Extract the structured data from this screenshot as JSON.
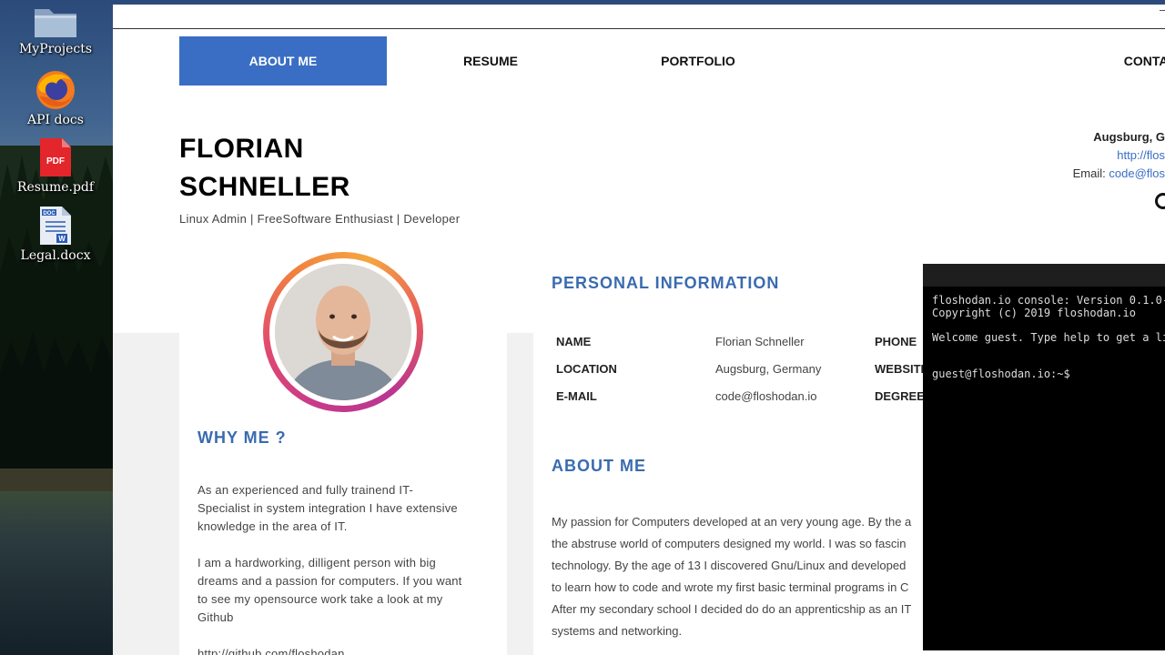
{
  "desktop": {
    "icons": [
      {
        "label": "MyProjects",
        "icon": "folder-icon"
      },
      {
        "label": "API docs",
        "icon": "firefox-icon"
      },
      {
        "label": "Resume.pdf",
        "icon": "pdf-file-icon",
        "badge": "PDF"
      },
      {
        "label": "Legal.docx",
        "icon": "docx-file-icon",
        "badge": "DOC"
      }
    ]
  },
  "nav": {
    "items": [
      {
        "label": "ABOUT ME",
        "active": true
      },
      {
        "label": "RESUME"
      },
      {
        "label": "PORTFOLIO"
      },
      {
        "label": "CONTACT ME"
      }
    ]
  },
  "profile": {
    "first_name": "FLORIAN",
    "last_name": "SCHNELLER",
    "tagline": "Linux Admin | FreeSoftware Enthusiast | Developer",
    "city": "Augsburg, G",
    "website": "http://flos",
    "email_label": "Email:",
    "email": "code@flos"
  },
  "why_me": {
    "title": "WHY ME ?",
    "para1_lines": [
      "As an experienced and fully trainend IT-",
      "Specialist in system integration I have extensive",
      "knowledge in the area of IT."
    ],
    "para2_lines": [
      "I am a hardworking, dilligent person with big",
      "dreams and a passion for computers. If you want",
      "to see my opensource work take a look at my",
      "Github"
    ],
    "github_link": "http://github.com/floshodan"
  },
  "personal_info": {
    "title": "PERSONAL INFORMATION",
    "rows": [
      {
        "key": "NAME",
        "value": "Florian Schneller",
        "key2": "PHONE"
      },
      {
        "key": "LOCATION",
        "value": "Augsburg, Germany",
        "key2": "WEBSITE"
      },
      {
        "key": "E-MAIL",
        "value": "code@floshodan.io",
        "key2": "DEGREE"
      }
    ]
  },
  "about_me": {
    "title": "ABOUT ME",
    "lines": [
      "My passion for Computers developed at an very young age. By the a",
      "the abstruse world of computers designed my world. I was so fascin",
      "technology. By the age of 13 I discovered Gnu/Linux and developed",
      "to learn how to code and wrote my first basic terminal programs in C",
      "After my secondary school I decided do do an apprenticship as an IT",
      "systems and networking."
    ]
  },
  "console": {
    "line1": "floshodan.io console: Version 0.1.0-",
    "line2": "Copyright (c) 2019 floshodan.io",
    "line3": "Welcome guest. Type help to get a li",
    "prompt": "guest@floshodan.io:~$"
  },
  "colors": {
    "accent": "#3a6ec4",
    "section_title": "#3a6bb0",
    "console_bg": "#000000"
  }
}
